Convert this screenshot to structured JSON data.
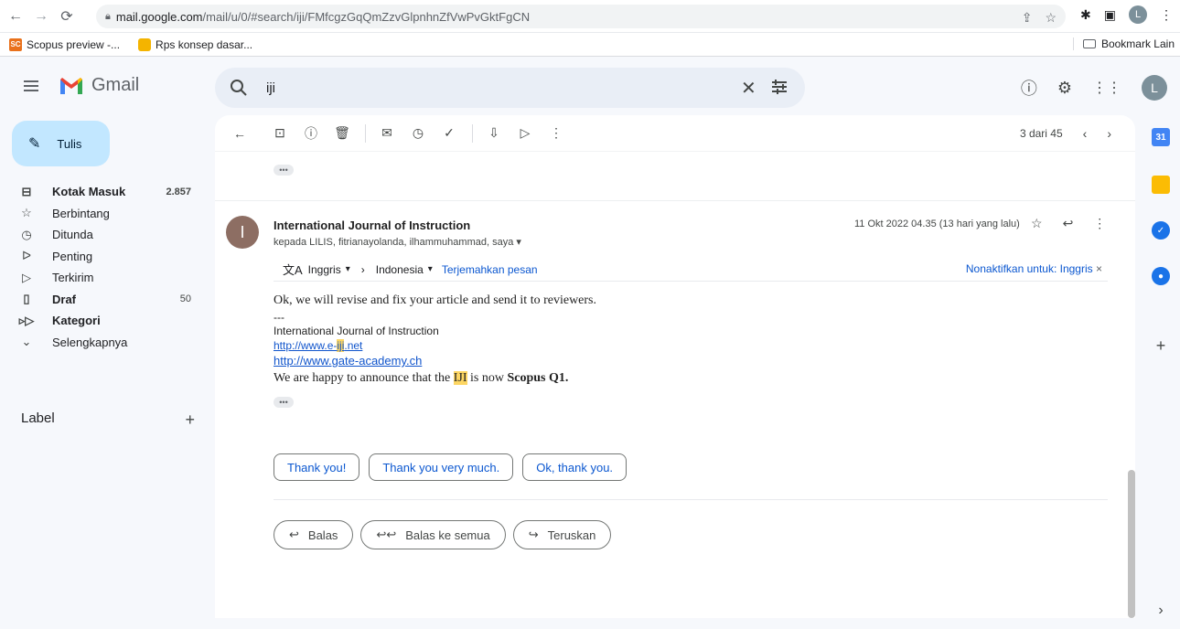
{
  "browser": {
    "url_host": "mail.google.com",
    "url_path": "/mail/u/0/#search/iji/FMfcgzGqQmZzvGlpnhnZfVwPvGktFgCN",
    "profile_initial": "L"
  },
  "bookmarks": {
    "items": [
      {
        "label": "Scopus preview -..."
      },
      {
        "label": "Rps konsep dasar..."
      }
    ],
    "other_label": "Bookmark Lain"
  },
  "gmail": {
    "app_name": "Gmail",
    "search_query": "iji",
    "avatar_initial": "L"
  },
  "sidebar": {
    "compose_label": "Tulis",
    "items": [
      {
        "label": "Kotak Masuk",
        "count": "2.857",
        "icon": "inbox-icon"
      },
      {
        "label": "Berbintang",
        "count": "",
        "icon": "star-icon"
      },
      {
        "label": "Ditunda",
        "count": "",
        "icon": "clock-icon"
      },
      {
        "label": "Penting",
        "count": "",
        "icon": "important-icon"
      },
      {
        "label": "Terkirim",
        "count": "",
        "icon": "send-icon"
      },
      {
        "label": "Draf",
        "count": "50",
        "icon": "draft-icon"
      },
      {
        "label": "Kategori",
        "count": "",
        "icon": "label-icon"
      },
      {
        "label": "Selengkapnya",
        "count": "",
        "icon": "chevron-down-icon"
      }
    ],
    "labels_heading": "Label"
  },
  "toolbar": {
    "pager": "3 dari 45"
  },
  "message": {
    "avatar_initial": "I",
    "sender": "International Journal of Instruction",
    "recipients": "kepada LILIS, fitrianayolanda, ilhammuhammad, saya",
    "date": "11 Okt 2022 04.35 (13 hari yang lalu)",
    "translate": {
      "from": "Inggris",
      "to": "Indonesia",
      "action": "Terjemahkan pesan",
      "disable": "Nonaktifkan untuk: Inggris"
    },
    "body_line1": "Ok, we will revise and fix your article and send it to reviewers.",
    "separator": "---",
    "sig_name": "International Journal of Instruction",
    "link1_pre": "http://www.e-",
    "link1_hl": "iji",
    "link1_post": ".net",
    "link2": "http://www.gate-academy.ch",
    "announce_pre": "We are happy to announce that the ",
    "announce_hl": "IJI",
    "announce_mid": " is now ",
    "announce_bold": "Scopus Q1."
  },
  "smart_replies": [
    "Thank you!",
    "Thank you very much.",
    "Ok, thank you."
  ],
  "reply_buttons": {
    "reply": "Balas",
    "reply_all": "Balas ke semua",
    "forward": "Teruskan"
  }
}
